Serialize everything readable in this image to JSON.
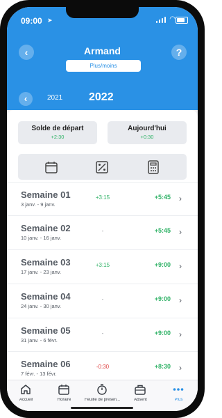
{
  "status": {
    "time": "09:00"
  },
  "header": {
    "title": "Armand",
    "back_label": "‹",
    "help_label": "?",
    "mode_button": "Plus/moins",
    "year_prev_label": "‹",
    "year_prev": "2021",
    "year_current": "2022"
  },
  "summary": {
    "start": {
      "label": "Solde de départ",
      "value": "+2:30"
    },
    "today": {
      "label": "Aujourd'hui",
      "value": "+0:30"
    }
  },
  "icons": [
    "calendar-icon",
    "percent-icon",
    "calculator-icon"
  ],
  "weeks": [
    {
      "label": "Semaine 01",
      "dates": "3 janv. - 9 janv.",
      "diff": "+3:15",
      "total": "+5:45"
    },
    {
      "label": "Semaine 02",
      "dates": "10 janv. - 16 janv.",
      "diff": "-",
      "total": "+5:45"
    },
    {
      "label": "Semaine 03",
      "dates": "17 janv. - 23 janv.",
      "diff": "+3:15",
      "total": "+9:00"
    },
    {
      "label": "Semaine 04",
      "dates": "24 janv. - 30 janv.",
      "diff": "-",
      "total": "+9:00"
    },
    {
      "label": "Semaine 05",
      "dates": "31 janv. - 6 févr.",
      "diff": "-",
      "total": "+9:00"
    },
    {
      "label": "Semaine 06",
      "dates": "7 févr. - 13 févr.",
      "diff": "-0:30",
      "total": "+8:30"
    }
  ],
  "chevron": "›",
  "tabs": [
    {
      "label": "Accueil"
    },
    {
      "label": "Horaire"
    },
    {
      "label": "Feuille de présen..."
    },
    {
      "label": "Absent"
    },
    {
      "label": "Plus"
    }
  ],
  "colors": {
    "primary": "#2a91e5",
    "positive": "#2fb266",
    "negative": "#e04a4a"
  }
}
